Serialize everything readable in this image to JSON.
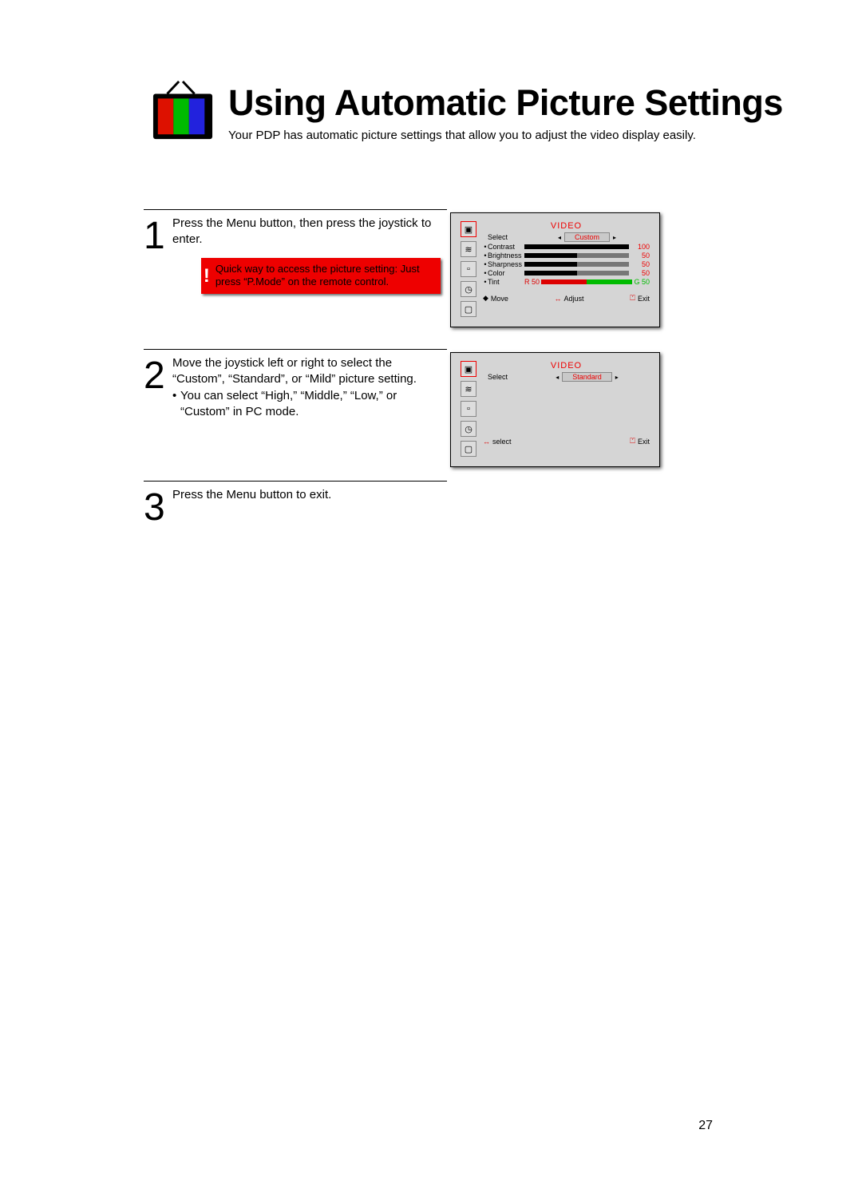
{
  "page_number": "27",
  "header": {
    "title": "Using Automatic Picture Settings",
    "intro": "Your PDP has automatic picture settings that allow you to adjust the video display easily."
  },
  "steps": {
    "s1": {
      "num": "1",
      "text": "Press the Menu button, then press the joystick to enter.",
      "tip": "Quick way to access the picture setting: Just press “P.Mode” on the remote control."
    },
    "s2": {
      "num": "2",
      "text": "Move the joystick left or right to select the “Custom”, “Standard”, or “Mild” picture setting.",
      "bullet": "You can select “High,” “Middle,” “Low,” or “Custom” in PC mode."
    },
    "s3": {
      "num": "3",
      "text": "Press the Menu button to exit."
    }
  },
  "osd1": {
    "title": "VIDEO",
    "select_label": "Select",
    "select_value": "Custom",
    "rows": {
      "contrast": {
        "label": "Contrast",
        "value": "100",
        "pct": 100
      },
      "brightness": {
        "label": "Brightness",
        "value": "50",
        "pct": 50
      },
      "sharpness": {
        "label": "Sharpness",
        "value": "50",
        "pct": 50
      },
      "color": {
        "label": "Color",
        "value": "50",
        "pct": 50
      },
      "tint": {
        "label": "Tint",
        "r": "R 50",
        "g": "G 50"
      }
    },
    "foot": {
      "move": "Move",
      "adjust": "Adjust",
      "exit": "Exit"
    }
  },
  "osd2": {
    "title": "VIDEO",
    "select_label": "Select",
    "select_value": "Standard",
    "foot": {
      "select": "select",
      "exit": "Exit"
    }
  }
}
